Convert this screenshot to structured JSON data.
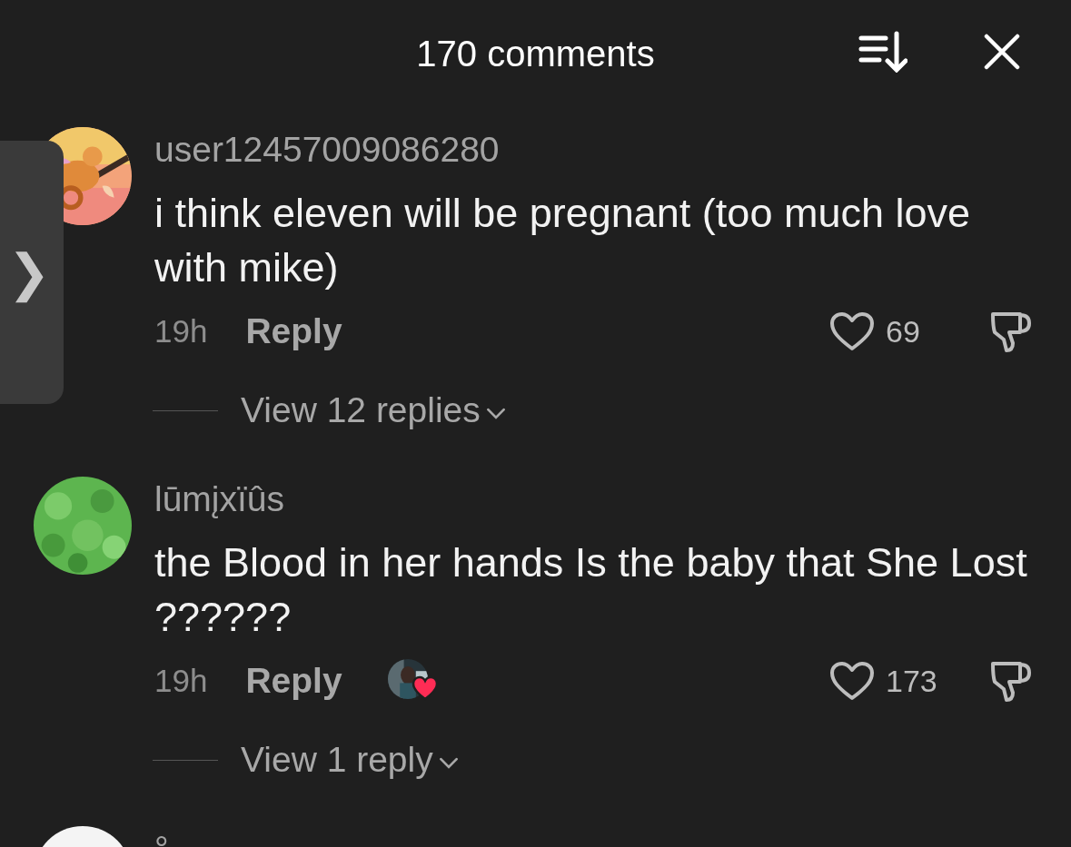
{
  "header": {
    "title": "170 comments"
  },
  "side_tab": {
    "glyph": "❯"
  },
  "comments": [
    {
      "username": "user12457009086280",
      "text": "i think eleven will be pregnant (too much love with mike)",
      "time": "19h",
      "reply_label": "Reply",
      "creator_liked": false,
      "likes": "69",
      "liked": false,
      "replies_label": "View 12 replies"
    },
    {
      "username": "lūmįxïûs",
      "text": "the Blood in her hands Is the baby that She Lost ??????",
      "time": "19h",
      "reply_label": "Reply",
      "creator_liked": true,
      "likes": "173",
      "liked": false,
      "replies_label": "View 1 reply"
    },
    {
      "username": "°"
    }
  ]
}
